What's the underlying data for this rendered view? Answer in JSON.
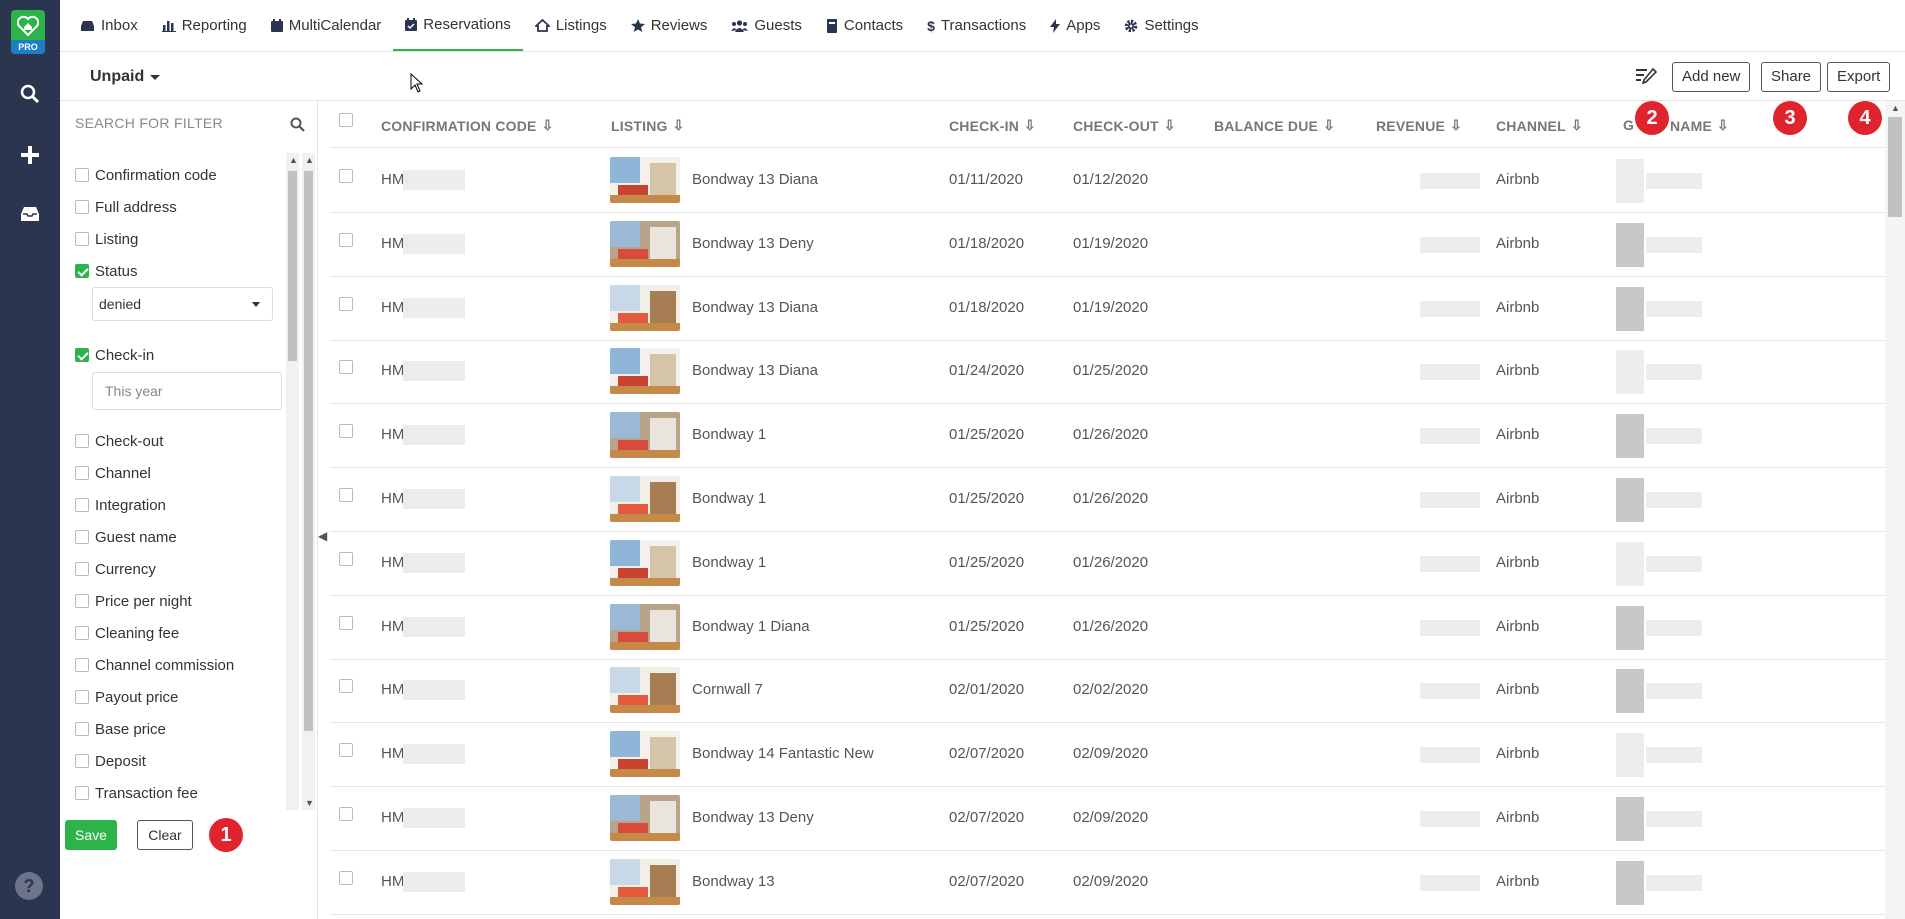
{
  "rail": {
    "logo_badge": "PRO",
    "help": "?"
  },
  "nav": [
    {
      "label": "Inbox",
      "icon": "inbox-icon"
    },
    {
      "label": "Reporting",
      "icon": "bar-chart-icon"
    },
    {
      "label": "MultiCalendar",
      "icon": "calendar-icon"
    },
    {
      "label": "Reservations",
      "icon": "calendar-check-icon",
      "active": true
    },
    {
      "label": "Listings",
      "icon": "home-icon"
    },
    {
      "label": "Reviews",
      "icon": "star-icon"
    },
    {
      "label": "Guests",
      "icon": "users-icon"
    },
    {
      "label": "Contacts",
      "icon": "address-book-icon"
    },
    {
      "label": "Transactions",
      "icon": "dollar-icon"
    },
    {
      "label": "Apps",
      "icon": "bolt-icon"
    },
    {
      "label": "Settings",
      "icon": "gear-icon"
    }
  ],
  "toolbar": {
    "view_label": "Unpaid",
    "add_new": "Add new",
    "share": "Share",
    "export": "Export"
  },
  "filter": {
    "search_placeholder": "SEARCH FOR FILTER",
    "items": [
      {
        "label": "Confirmation code",
        "checked": false
      },
      {
        "label": "Full address",
        "checked": false
      },
      {
        "label": "Listing",
        "checked": false
      },
      {
        "label": "Status",
        "checked": true
      },
      {
        "label": "Check-in",
        "checked": true
      },
      {
        "label": "Check-out",
        "checked": false
      },
      {
        "label": "Channel",
        "checked": false
      },
      {
        "label": "Integration",
        "checked": false
      },
      {
        "label": "Guest name",
        "checked": false
      },
      {
        "label": "Currency",
        "checked": false
      },
      {
        "label": "Price per night",
        "checked": false
      },
      {
        "label": "Cleaning fee",
        "checked": false
      },
      {
        "label": "Channel commission",
        "checked": false
      },
      {
        "label": "Payout price",
        "checked": false
      },
      {
        "label": "Base price",
        "checked": false
      },
      {
        "label": "Deposit",
        "checked": false
      },
      {
        "label": "Transaction fee",
        "checked": false
      }
    ],
    "status_value": "denied",
    "checkin_placeholder": "This year",
    "save": "Save",
    "clear": "Clear"
  },
  "badges": [
    "1",
    "2",
    "3",
    "4"
  ],
  "table": {
    "columns": [
      "CONFIRMATION CODE",
      "LISTING",
      "CHECK-IN",
      "CHECK-OUT",
      "BALANCE DUE",
      "REVENUE",
      "CHANNEL",
      "G",
      "NAME"
    ],
    "rows": [
      {
        "code": "HM!",
        "listing": "Bondway 13 Diana",
        "checkin": "01/11/2020",
        "checkout": "01/12/2020",
        "channel": "Airbnb"
      },
      {
        "code": "HMI",
        "listing": "Bondway 13 Deny",
        "checkin": "01/18/2020",
        "checkout": "01/19/2020",
        "channel": "Airbnb"
      },
      {
        "code": "HM!",
        "listing": "Bondway 13 Diana",
        "checkin": "01/18/2020",
        "checkout": "01/19/2020",
        "channel": "Airbnb"
      },
      {
        "code": "HMI",
        "listing": "Bondway 13 Diana",
        "checkin": "01/24/2020",
        "checkout": "01/25/2020",
        "channel": "Airbnb"
      },
      {
        "code": "HM;",
        "listing": "Bondway 1",
        "checkin": "01/25/2020",
        "checkout": "01/26/2020",
        "channel": "Airbnb"
      },
      {
        "code": "HMJ",
        "listing": "Bondway 1",
        "checkin": "01/25/2020",
        "checkout": "01/26/2020",
        "channel": "Airbnb"
      },
      {
        "code": "HMI",
        "listing": "Bondway 1",
        "checkin": "01/25/2020",
        "checkout": "01/26/2020",
        "channel": "Airbnb"
      },
      {
        "code": "HM;",
        "listing": "Bondway 1 Diana",
        "checkin": "01/25/2020",
        "checkout": "01/26/2020",
        "channel": "Airbnb"
      },
      {
        "code": "HM/",
        "listing": "Cornwall 7",
        "checkin": "02/01/2020",
        "checkout": "02/02/2020",
        "channel": "Airbnb"
      },
      {
        "code": "HM!",
        "listing": "Bondway 14 Fantastic New",
        "checkin": "02/07/2020",
        "checkout": "02/09/2020",
        "channel": "Airbnb"
      },
      {
        "code": "HM/",
        "listing": "Bondway 13 Deny",
        "checkin": "02/07/2020",
        "checkout": "02/09/2020",
        "channel": "Airbnb"
      },
      {
        "code": "HM(",
        "listing": "Bondway 13",
        "checkin": "02/07/2020",
        "checkout": "02/09/2020",
        "channel": "Airbnb"
      }
    ]
  },
  "colors": {
    "rail": "#2b3550",
    "accent": "#2cb34a",
    "badge": "#e0242d",
    "pro": "#1b7fc2"
  }
}
